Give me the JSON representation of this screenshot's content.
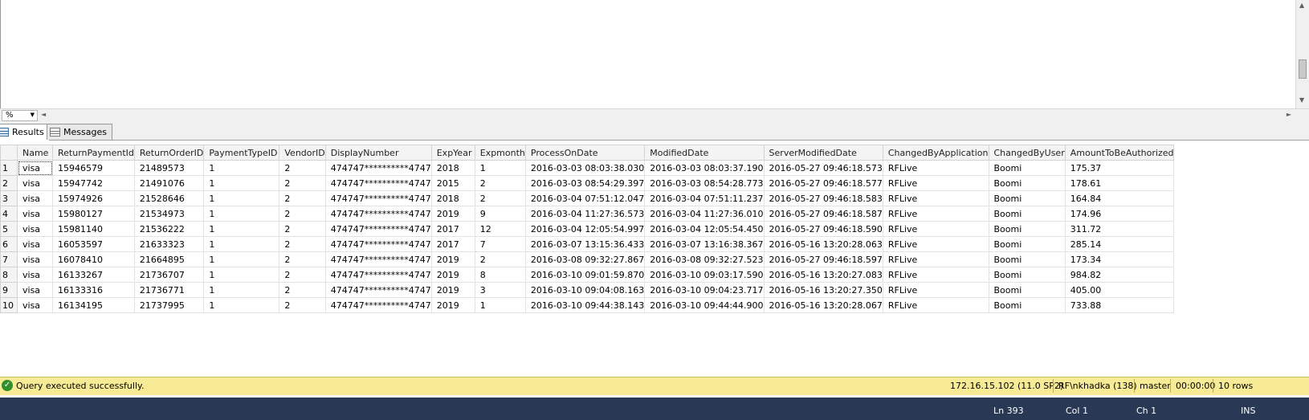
{
  "zoom": {
    "value": "%"
  },
  "tabs": [
    {
      "label": "Results",
      "active": true
    },
    {
      "label": "Messages",
      "active": false
    }
  ],
  "grid": {
    "columns": [
      "Name",
      "ReturnPaymentId",
      "ReturnOrderID",
      "PaymentTypeID",
      "VendorID",
      "DisplayNumber",
      "ExpYear",
      "Expmonth",
      "ProcessOnDate",
      "ModifiedDate",
      "ServerModifiedDate",
      "ChangedByApplication",
      "ChangedByUser",
      "AmountToBeAuthorized"
    ],
    "rows": [
      [
        "1",
        "visa",
        "15946579",
        "21489573",
        "1",
        "2",
        "474747**********4747",
        "2018",
        "1",
        "2016-03-03 08:03:38.030",
        "2016-03-03 08:03:37.190",
        "2016-05-27 09:46:18.573",
        "RFLive",
        "Boomi",
        "175.37"
      ],
      [
        "2",
        "visa",
        "15947742",
        "21491076",
        "1",
        "2",
        "474747**********4747",
        "2015",
        "2",
        "2016-03-03 08:54:29.397",
        "2016-03-03 08:54:28.773",
        "2016-05-27 09:46:18.577",
        "RFLive",
        "Boomi",
        "178.61"
      ],
      [
        "3",
        "visa",
        "15974926",
        "21528646",
        "1",
        "2",
        "474747**********4747",
        "2018",
        "2",
        "2016-03-04 07:51:12.047",
        "2016-03-04 07:51:11.237",
        "2016-05-27 09:46:18.583",
        "RFLive",
        "Boomi",
        "164.84"
      ],
      [
        "4",
        "visa",
        "15980127",
        "21534973",
        "1",
        "2",
        "474747**********4747",
        "2019",
        "9",
        "2016-03-04 11:27:36.573",
        "2016-03-04 11:27:36.010",
        "2016-05-27 09:46:18.587",
        "RFLive",
        "Boomi",
        "174.96"
      ],
      [
        "5",
        "visa",
        "15981140",
        "21536222",
        "1",
        "2",
        "474747**********4747",
        "2017",
        "12",
        "2016-03-04 12:05:54.997",
        "2016-03-04 12:05:54.450",
        "2016-05-27 09:46:18.590",
        "RFLive",
        "Boomi",
        "311.72"
      ],
      [
        "6",
        "visa",
        "16053597",
        "21633323",
        "1",
        "2",
        "474747**********4747",
        "2017",
        "7",
        "2016-03-07 13:15:36.433",
        "2016-03-07 13:16:38.367",
        "2016-05-16 13:20:28.063",
        "RFLive",
        "Boomi",
        "285.14"
      ],
      [
        "7",
        "visa",
        "16078410",
        "21664895",
        "1",
        "2",
        "474747**********4747",
        "2019",
        "2",
        "2016-03-08 09:32:27.867",
        "2016-03-08 09:32:27.523",
        "2016-05-27 09:46:18.597",
        "RFLive",
        "Boomi",
        "173.34"
      ],
      [
        "8",
        "visa",
        "16133267",
        "21736707",
        "1",
        "2",
        "474747**********4747",
        "2019",
        "8",
        "2016-03-10 09:01:59.870",
        "2016-03-10 09:03:17.590",
        "2016-05-16 13:20:27.083",
        "RFLive",
        "Boomi",
        "984.82"
      ],
      [
        "9",
        "visa",
        "16133316",
        "21736771",
        "1",
        "2",
        "474747**********4747",
        "2019",
        "3",
        "2016-03-10 09:04:08.163",
        "2016-03-10 09:04:23.717",
        "2016-05-16 13:20:27.350",
        "RFLive",
        "Boomi",
        "405.00"
      ],
      [
        "10",
        "visa",
        "16134195",
        "21737995",
        "1",
        "2",
        "474747**********4747",
        "2019",
        "1",
        "2016-03-10 09:44:38.143",
        "2016-03-10 09:44:44.900",
        "2016-05-16 13:20:28.067",
        "RFLive",
        "Boomi",
        "733.88"
      ]
    ]
  },
  "status": {
    "message": "Query executed successfully.",
    "server": "172.16.15.102 (11.0 SP2)",
    "user": "RF\\nkhadka (138)",
    "database": "master",
    "elapsed": "00:00:00",
    "row_count": "10 rows"
  },
  "bottombar": {
    "line": "Ln 393",
    "col": "Col 1",
    "ch": "Ch 1",
    "mode": "INS"
  },
  "colors": {
    "status_bg": "#f7eb95",
    "bottombar_bg": "#293955"
  }
}
